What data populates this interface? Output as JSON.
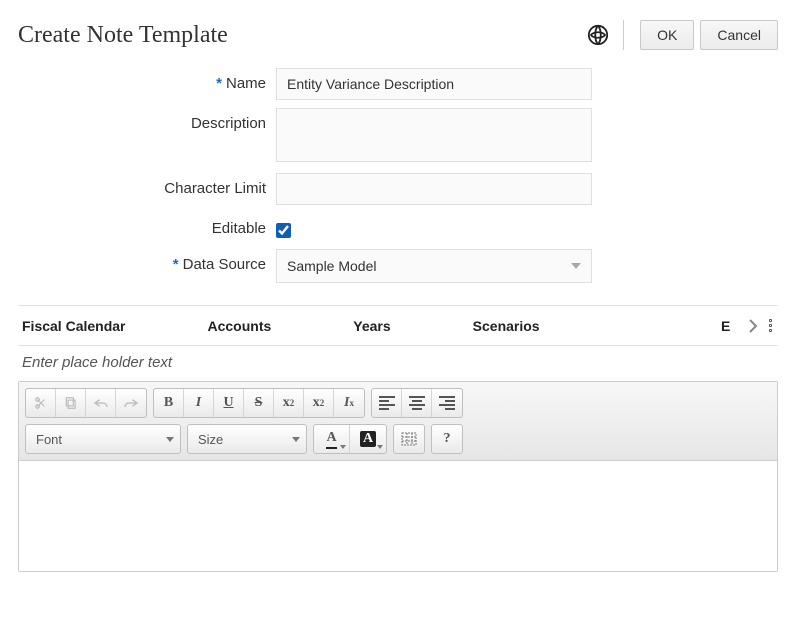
{
  "header": {
    "title": "Create Note Template",
    "ok_label": "OK",
    "cancel_label": "Cancel"
  },
  "form": {
    "name": {
      "label": "Name",
      "required": true,
      "value": "Entity Variance Description"
    },
    "description": {
      "label": "Description",
      "required": false,
      "value": ""
    },
    "char_limit": {
      "label": "Character Limit",
      "required": false,
      "value": ""
    },
    "editable": {
      "label": "Editable",
      "required": false,
      "checked": true
    },
    "data_source": {
      "label": "Data Source",
      "required": true,
      "value": "Sample Model"
    }
  },
  "dimensions": {
    "items": [
      "Fiscal Calendar",
      "Accounts",
      "Years",
      "Scenarios"
    ],
    "next_partial": "E"
  },
  "editor": {
    "placeholder_hint": "Enter place holder text",
    "font_label": "Font",
    "size_label": "Size",
    "content": ""
  },
  "colors": {
    "required_asterisk": "#1a6bc5"
  }
}
